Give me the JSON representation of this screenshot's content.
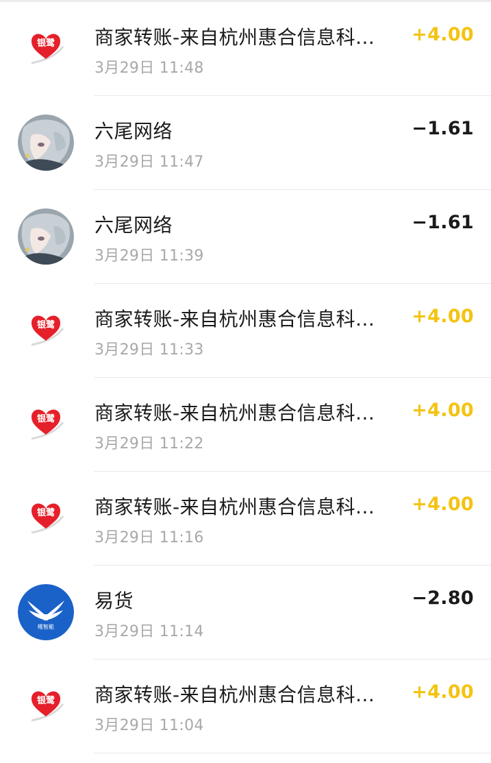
{
  "colors": {
    "income": "#f4c312",
    "expense": "#1a1a1a",
    "yinlu_red": "#e5202a",
    "yihuo_blue": "#1a62c8"
  },
  "transactions": [
    {
      "title": "商家转账-来自杭州惠合信息科...",
      "time": "3月29日 11:48",
      "amount": "+4.00",
      "type": "income",
      "icon": "yinlu-logo-icon",
      "logo_text": "银鹭"
    },
    {
      "title": "六尾网络",
      "time": "3月29日 11:47",
      "amount": "−1.61",
      "type": "expense",
      "icon": "anime-avatar-icon"
    },
    {
      "title": "六尾网络",
      "time": "3月29日 11:39",
      "amount": "−1.61",
      "type": "expense",
      "icon": "anime-avatar-icon"
    },
    {
      "title": "商家转账-来自杭州惠合信息科...",
      "time": "3月29日 11:33",
      "amount": "+4.00",
      "type": "income",
      "icon": "yinlu-logo-icon",
      "logo_text": "银鹭"
    },
    {
      "title": "商家转账-来自杭州惠合信息科...",
      "time": "3月29日 11:22",
      "amount": "+4.00",
      "type": "income",
      "icon": "yinlu-logo-icon",
      "logo_text": "银鹭"
    },
    {
      "title": "商家转账-来自杭州惠合信息科...",
      "time": "3月29日 11:16",
      "amount": "+4.00",
      "type": "income",
      "icon": "yinlu-logo-icon",
      "logo_text": "银鹭"
    },
    {
      "title": "易货",
      "time": "3月29日 11:14",
      "amount": "−2.80",
      "type": "expense",
      "icon": "yihuo-wings-logo-icon",
      "logo_text": "帷智能"
    },
    {
      "title": "商家转账-来自杭州惠合信息科...",
      "time": "3月29日 11:04",
      "amount": "+4.00",
      "type": "income",
      "icon": "yinlu-logo-icon",
      "logo_text": "银鹭"
    }
  ]
}
